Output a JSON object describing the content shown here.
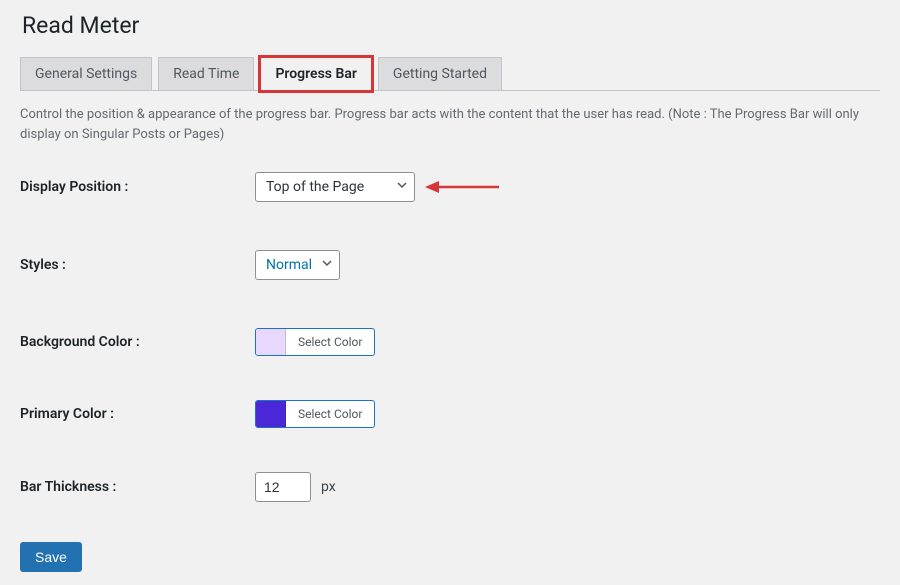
{
  "header": {
    "title": "Read Meter"
  },
  "tabs": {
    "general": "General Settings",
    "read_time": "Read Time",
    "progress_bar": "Progress Bar",
    "getting_started": "Getting Started"
  },
  "description": "Control the position & appearance of the progress bar. Progress bar acts with the content that the user has read. (Note : The Progress Bar will only display on Singular Posts or Pages)",
  "fields": {
    "display_position": {
      "label": "Display Position :",
      "value": "Top of the Page"
    },
    "styles": {
      "label": "Styles :",
      "value": "Normal"
    },
    "background_color": {
      "label": "Background Color :",
      "button": "Select Color",
      "swatch": "#e9d8fd"
    },
    "primary_color": {
      "label": "Primary Color :",
      "button": "Select Color",
      "swatch": "#4b28d7"
    },
    "bar_thickness": {
      "label": "Bar Thickness :",
      "value": "12",
      "unit": "px"
    }
  },
  "actions": {
    "save": "Save"
  }
}
